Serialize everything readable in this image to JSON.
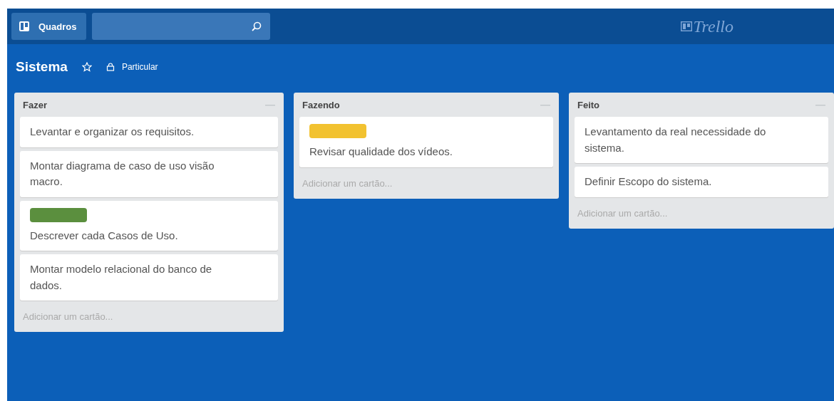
{
  "header": {
    "boards_button": "Quadros",
    "logo": "Trello"
  },
  "board": {
    "title": "Sistema",
    "starred": false,
    "visibility": "Particular"
  },
  "lists": [
    {
      "title": "Fazer",
      "cards": [
        {
          "text": "Levantar e organizar os requisitos."
        },
        {
          "text": "Montar diagrama de caso de uso visão macro."
        },
        {
          "text": "Descrever cada Casos de Uso.",
          "labels": [
            {
              "color": "#5b8f3e"
            }
          ]
        },
        {
          "text": "Montar modelo relacional do banco de dados."
        }
      ],
      "add_card": "Adicionar um cartão..."
    },
    {
      "title": "Fazendo",
      "cards": [
        {
          "text": "Revisar qualidade dos vídeos.",
          "labels": [
            {
              "color": "#f2c230"
            }
          ]
        }
      ],
      "add_card": "Adicionar um cartão..."
    },
    {
      "title": "Feito",
      "cards": [
        {
          "text": "Levantamento da real necessidade do sistema."
        },
        {
          "text": "Definir Escopo do sistema."
        }
      ],
      "add_card": "Adicionar um cartão..."
    }
  ]
}
